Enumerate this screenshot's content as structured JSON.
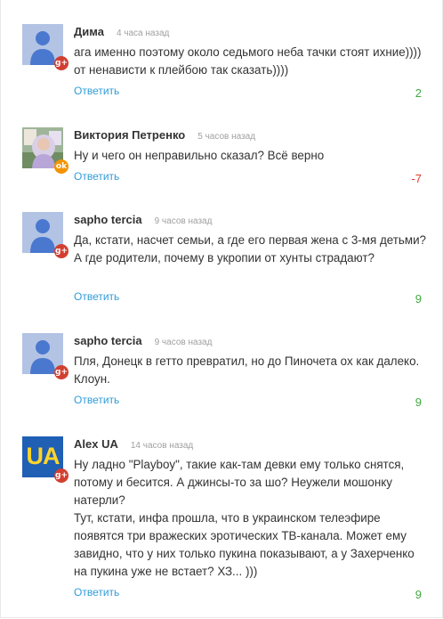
{
  "colors": {
    "reply": "#2f9cd8",
    "positive": "#41a841",
    "negative": "#e0392b",
    "gplus": "#d23f31",
    "odnoklassniki": "#f29400"
  },
  "comments": [
    {
      "name": "Дима",
      "time": "4 часа назад",
      "network_icon": "google-plus-icon",
      "network_glyph": "g+",
      "avatar": "default-avatar",
      "text": "ага именно поэтому около седьмого неба тачки стоят ихние)))) от ненависти к плейбою так сказать))))",
      "reply": "Ответить",
      "score": "2"
    },
    {
      "name": "Виктория Петренко",
      "time": "5 часов назад",
      "network_icon": "odnoklassniki-icon",
      "network_glyph": "ok",
      "avatar": "photo-avatar",
      "text": "Ну и чего он неправильно сказал? Всё верно",
      "reply": "Ответить",
      "score": "-7"
    },
    {
      "name": "sapho tercia",
      "time": "9 часов назад",
      "network_icon": "google-plus-icon",
      "network_glyph": "g+",
      "avatar": "default-avatar",
      "text": "Да, кстати, насчет семьи, а где его первая жена с 3-мя детьми? А где родители, почему в укропии от хунты страдают?",
      "reply": "Ответить",
      "score": "9"
    },
    {
      "name": "sapho tercia",
      "time": "9 часов назад",
      "network_icon": "google-plus-icon",
      "network_glyph": "g+",
      "avatar": "default-avatar",
      "text": "Пля, Донецк в гетто превратил, но до Пиночета ох как далеко. Клоун.",
      "reply": "Ответить",
      "score": "9"
    },
    {
      "name": "Alex UA",
      "time": "14 часов назад",
      "network_icon": "google-plus-icon",
      "network_glyph": "g+",
      "avatar": "ua-avatar",
      "avatar_text": "UA",
      "text": "Ну ладно \"Playboy\", такие как-там девки ему только снятся, потому и бесится. А джинсы-то за шо? Неужели мошонку натерли?\nТут, кстати, инфа прошла, что в украинском телеэфире появятся три вражеских эротических ТВ-канала. Может ему завидно, что у них только пукина показывают, а у Захерченко на пукина уже не встает? ХЗ... )))",
      "reply": "Ответить",
      "score": "9"
    }
  ]
}
